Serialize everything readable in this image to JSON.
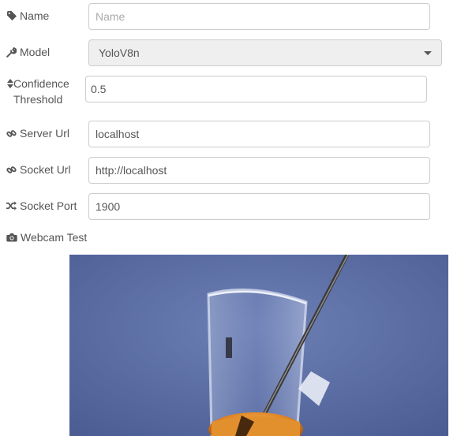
{
  "form": {
    "name": {
      "label": "Name",
      "placeholder": "Name",
      "value": "",
      "icon": "tag-icon"
    },
    "model": {
      "label": "Model",
      "value": "YoloV8n",
      "icon": "wrench-icon"
    },
    "confidence": {
      "label": "Confidence Threshold",
      "value": "0.5",
      "icon": "sort-icon"
    },
    "server_url": {
      "label": "Server Url",
      "value": "localhost",
      "icon": "link-icon"
    },
    "socket_url": {
      "label": "Socket Url",
      "value": "http://localhost",
      "icon": "link-icon"
    },
    "socket_port": {
      "label": "Socket Port",
      "value": "1900",
      "icon": "random-icon"
    }
  },
  "webcam": {
    "label": "Webcam Test",
    "icon": "camera-icon"
  },
  "colors": {
    "text": "#555555",
    "border": "#cccccc",
    "select_bg": "#efefef",
    "placeholder": "#aaaaaa"
  }
}
